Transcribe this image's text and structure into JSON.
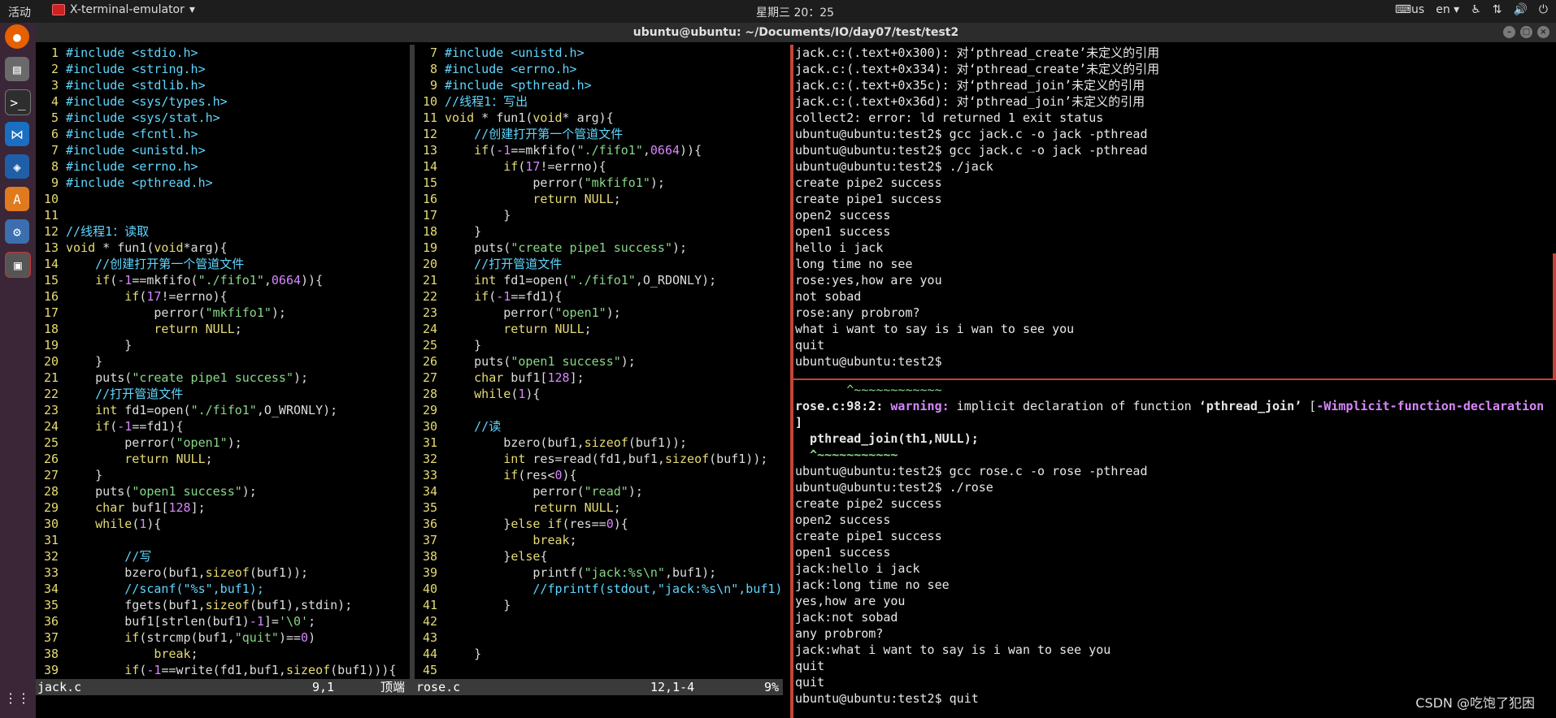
{
  "topbar": {
    "activities": "活动",
    "app_name": "X-terminal-emulator",
    "clock": "星期三 20：25",
    "keyboard": "us",
    "lang": "en"
  },
  "window": {
    "title": "ubuntu@ubuntu: ~/Documents/IO/day07/test/test2"
  },
  "dock": {
    "items": [
      "firefox-icon",
      "files-icon",
      "terminal-icon",
      "vscode-icon",
      "virtualbox-icon",
      "software-icon",
      "settings-icon",
      "terminal-active-icon"
    ]
  },
  "left_editor": {
    "lines": [
      {
        "n": "1",
        "t": "#include <stdio.h>"
      },
      {
        "n": "2",
        "t": "#include <string.h>"
      },
      {
        "n": "3",
        "t": "#include <stdlib.h>"
      },
      {
        "n": "4",
        "t": "#include <sys/types.h>"
      },
      {
        "n": "5",
        "t": "#include <sys/stat.h>"
      },
      {
        "n": "6",
        "t": "#include <fcntl.h>"
      },
      {
        "n": "7",
        "t": "#include <unistd.h>"
      },
      {
        "n": "8",
        "t": "#include <errno.h>"
      },
      {
        "n": "9",
        "t": "#include <pthread.h>"
      },
      {
        "n": "10",
        "t": ""
      },
      {
        "n": "11",
        "t": ""
      },
      {
        "n": "12",
        "t": "//线程1：读取"
      },
      {
        "n": "13",
        "t": "void * fun1(void*arg){"
      },
      {
        "n": "14",
        "t": "    //创建打开第一个管道文件"
      },
      {
        "n": "15",
        "t": "    if(-1==mkfifo(\"./fifo1\",0664)){"
      },
      {
        "n": "16",
        "t": "        if(17!=errno){"
      },
      {
        "n": "17",
        "t": "            perror(\"mkfifo1\");"
      },
      {
        "n": "18",
        "t": "            return NULL;"
      },
      {
        "n": "19",
        "t": "        }"
      },
      {
        "n": "20",
        "t": "    }"
      },
      {
        "n": "21",
        "t": "    puts(\"create pipe1 success\");"
      },
      {
        "n": "22",
        "t": "    //打开管道文件"
      },
      {
        "n": "23",
        "t": "    int fd1=open(\"./fifo1\",O_WRONLY);"
      },
      {
        "n": "24",
        "t": "    if(-1==fd1){"
      },
      {
        "n": "25",
        "t": "        perror(\"open1\");"
      },
      {
        "n": "26",
        "t": "        return NULL;"
      },
      {
        "n": "27",
        "t": "    }"
      },
      {
        "n": "28",
        "t": "    puts(\"open1 success\");"
      },
      {
        "n": "29",
        "t": "    char buf1[128];"
      },
      {
        "n": "30",
        "t": "    while(1){"
      },
      {
        "n": "31",
        "t": ""
      },
      {
        "n": "32",
        "t": "        //写"
      },
      {
        "n": "33",
        "t": "        bzero(buf1,sizeof(buf1));"
      },
      {
        "n": "34",
        "t": "        //scanf(\"%s\",buf1);"
      },
      {
        "n": "35",
        "t": "        fgets(buf1,sizeof(buf1),stdin);"
      },
      {
        "n": "36",
        "t": "        buf1[strlen(buf1)-1]='\\0';"
      },
      {
        "n": "37",
        "t": "        if(strcmp(buf1,\"quit\")==0)"
      },
      {
        "n": "38",
        "t": "            break;"
      },
      {
        "n": "39",
        "t": "        if(-1==write(fd1,buf1,sizeof(buf1))){"
      }
    ],
    "status": {
      "file": "jack.c",
      "pos": "9,1",
      "scroll": "顶端"
    }
  },
  "mid_editor": {
    "lines": [
      {
        "n": "7",
        "t": "#include <unistd.h>"
      },
      {
        "n": "8",
        "t": "#include <errno.h>"
      },
      {
        "n": "9",
        "t": "#include <pthread.h>"
      },
      {
        "n": "10",
        "t": "//线程1：写出"
      },
      {
        "n": "11",
        "t": "void * fun1(void* arg){"
      },
      {
        "n": "12",
        "t": "    //创建打开第一个管道文件"
      },
      {
        "n": "13",
        "t": "    if(-1==mkfifo(\"./fifo1\",0664)){"
      },
      {
        "n": "14",
        "t": "        if(17!=errno){"
      },
      {
        "n": "15",
        "t": "            perror(\"mkfifo1\");"
      },
      {
        "n": "16",
        "t": "            return NULL;"
      },
      {
        "n": "17",
        "t": "        }"
      },
      {
        "n": "18",
        "t": "    }"
      },
      {
        "n": "19",
        "t": "    puts(\"create pipe1 success\");"
      },
      {
        "n": "20",
        "t": "    //打开管道文件"
      },
      {
        "n": "21",
        "t": "    int fd1=open(\"./fifo1\",O_RDONLY);"
      },
      {
        "n": "22",
        "t": "    if(-1==fd1){"
      },
      {
        "n": "23",
        "t": "        perror(\"open1\");"
      },
      {
        "n": "24",
        "t": "        return NULL;"
      },
      {
        "n": "25",
        "t": "    }"
      },
      {
        "n": "26",
        "t": "    puts(\"open1 success\");"
      },
      {
        "n": "27",
        "t": "    char buf1[128];"
      },
      {
        "n": "28",
        "t": "    while(1){"
      },
      {
        "n": "29",
        "t": ""
      },
      {
        "n": "30",
        "t": "    //读"
      },
      {
        "n": "31",
        "t": "        bzero(buf1,sizeof(buf1));"
      },
      {
        "n": "32",
        "t": "        int res=read(fd1,buf1,sizeof(buf1));"
      },
      {
        "n": "33",
        "t": "        if(res<0){"
      },
      {
        "n": "34",
        "t": "            perror(\"read\");"
      },
      {
        "n": "35",
        "t": "            return NULL;"
      },
      {
        "n": "36",
        "t": "        }else if(res==0){"
      },
      {
        "n": "37",
        "t": "            break;"
      },
      {
        "n": "38",
        "t": "        }else{"
      },
      {
        "n": "39",
        "t": "            printf(\"jack:%s\\n\",buf1);"
      },
      {
        "n": "40",
        "t": "            //fprintf(stdout,\"jack:%s\\n\",buf1)"
      },
      {
        "n": "41",
        "t": "        }"
      },
      {
        "n": "42",
        "t": ""
      },
      {
        "n": "43",
        "t": ""
      },
      {
        "n": "44",
        "t": "    }"
      },
      {
        "n": "45",
        "t": ""
      }
    ],
    "status": {
      "file": "rose.c",
      "pos": "12,1-4",
      "scroll": "9%"
    }
  },
  "terminal_top": {
    "lines": [
      "jack.c:(.text+0x300): 对‘pthread_create’未定义的引用",
      "jack.c:(.text+0x334): 对‘pthread_create’未定义的引用",
      "jack.c:(.text+0x35c): 对‘pthread_join’未定义的引用",
      "jack.c:(.text+0x36d): 对‘pthread_join’未定义的引用",
      "collect2: error: ld returned 1 exit status",
      "ubuntu@ubuntu:test2$ gcc jack.c -o jack -pthread",
      "ubuntu@ubuntu:test2$ gcc jack.c -o jack -pthread",
      "ubuntu@ubuntu:test2$ ./jack",
      "create pipe2 success",
      "create pipe1 success",
      "open2 success",
      "open1 success",
      "hello i jack",
      "long time no see",
      "rose:yes,how are you",
      "not sobad",
      "rose:any probrom?",
      "what i want to say is i wan to see you",
      "quit",
      "ubuntu@ubuntu:test2$"
    ]
  },
  "terminal_bottom": {
    "tilde_line": "       ^~~~~~~~~~~~~",
    "warning": {
      "loc": "rose.c:98:2: ",
      "label": "warning:",
      "msg": " implicit declaration of function ",
      "fn": "‘pthread_join’",
      "flag_open": " [",
      "flag": "-Wimplicit-function-declaration",
      "flag_close": "]"
    },
    "call_line": "  pthread_join(th1,NULL);",
    "caret_line": "  ^~~~~~~~~~~~",
    "lines": [
      "ubuntu@ubuntu:test2$ gcc rose.c -o rose -pthread",
      "ubuntu@ubuntu:test2$ ./rose",
      "create pipe2 success",
      "open2 success",
      "create pipe1 success",
      "open1 success",
      "jack:hello i jack",
      "jack:long time no see",
      "yes,how are you",
      "jack:not sobad",
      "any probrom?",
      "jack:what i want to say is i wan to see you",
      "quit",
      "quit",
      "ubuntu@ubuntu:test2$ quit"
    ]
  },
  "watermark": "CSDN @吃饱了犯困"
}
